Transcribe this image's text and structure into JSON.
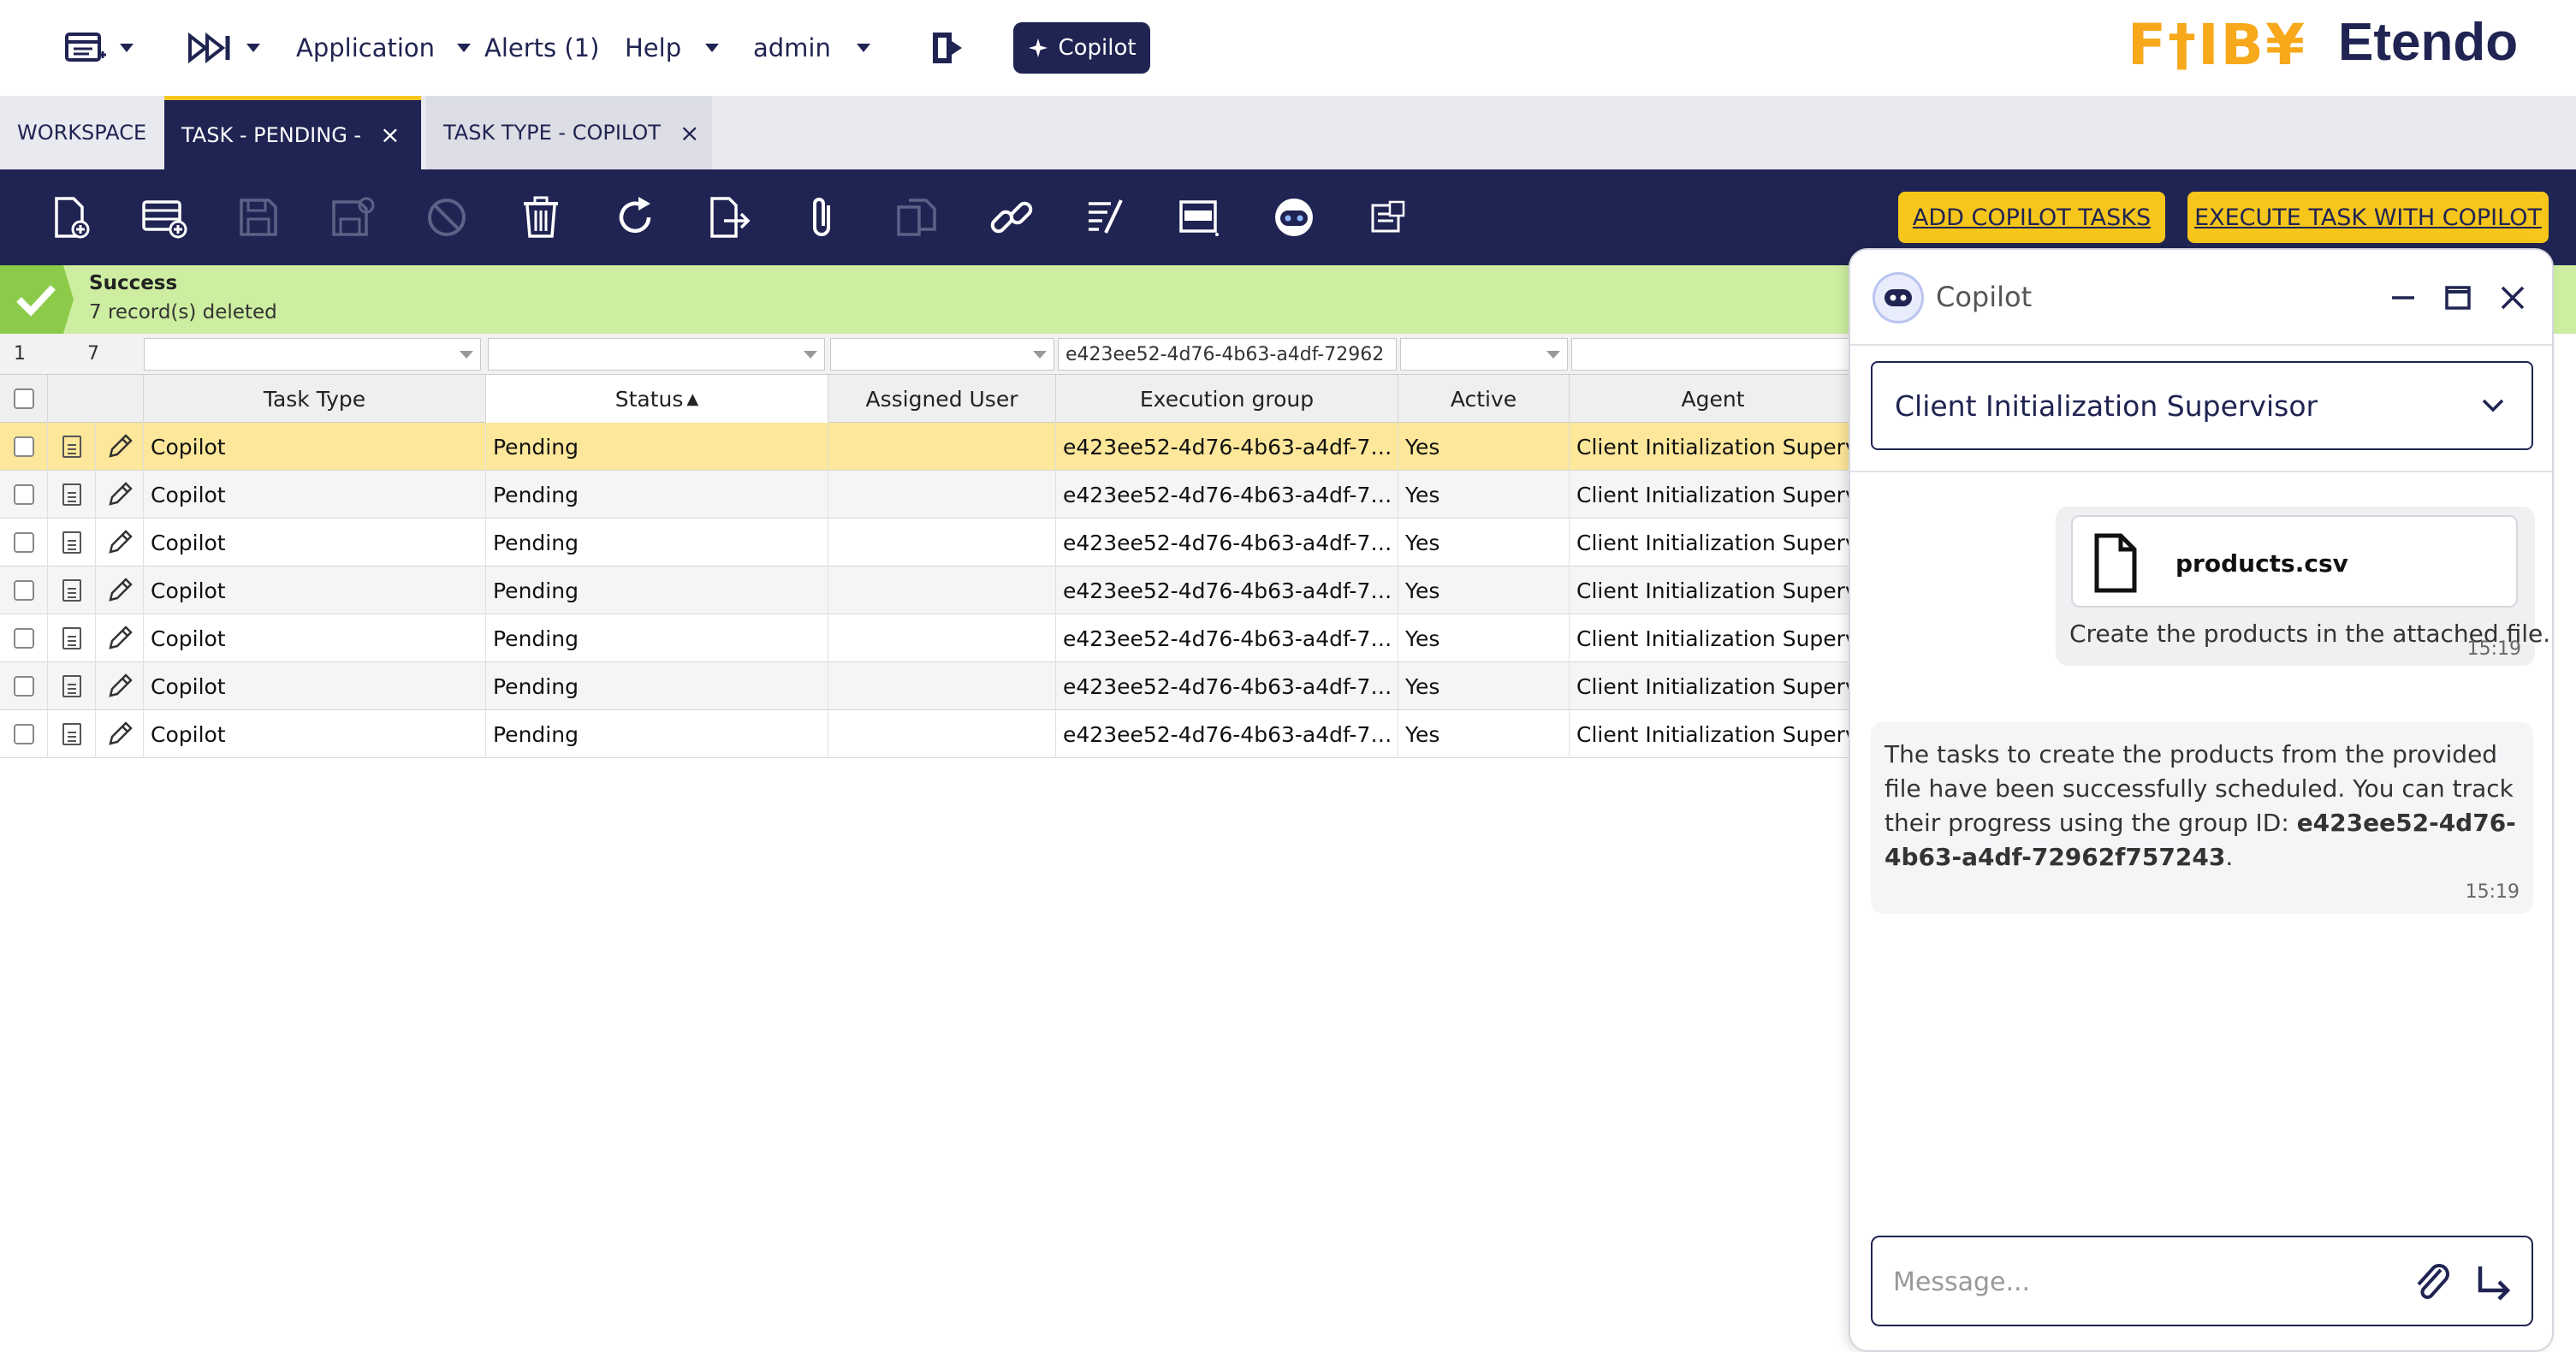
{
  "topbar": {
    "menus": [
      "Application",
      "Alerts (1)",
      "Help",
      "admin"
    ],
    "copilot_label": "Copilot",
    "logo_left": "F†IB¥",
    "logo_right": "Etendo"
  },
  "tabs": [
    {
      "label": "WORKSPACE",
      "closable": false
    },
    {
      "label": "TASK - PENDING -",
      "closable": true,
      "active": true
    },
    {
      "label": "TASK TYPE - COPILOT",
      "closable": true
    }
  ],
  "toolbar": {
    "add_tasks_label": "ADD COPILOT TASKS",
    "execute_label": "EXECUTE TASK WITH COPILOT"
  },
  "message": {
    "title": "Success",
    "text": "7 record(s) deleted",
    "color": "#8ccb4a"
  },
  "grid": {
    "filter_selected": "1",
    "filter_total": "7",
    "filter_execution_group": "e423ee52-4d76-4b63-a4df-72962",
    "columns": [
      "Task Type",
      "Status",
      "Assigned User",
      "Execution group",
      "Active",
      "Agent"
    ],
    "sort_column": "Status",
    "rows": [
      {
        "task_type": "Copilot",
        "status": "Pending",
        "assigned_user": "",
        "execution_group": "e423ee52-4d76-4b63-a4df-7…",
        "active": "Yes",
        "agent": "Client Initialization Supervisor"
      },
      {
        "task_type": "Copilot",
        "status": "Pending",
        "assigned_user": "",
        "execution_group": "e423ee52-4d76-4b63-a4df-7…",
        "active": "Yes",
        "agent": "Client Initialization Supervisor"
      },
      {
        "task_type": "Copilot",
        "status": "Pending",
        "assigned_user": "",
        "execution_group": "e423ee52-4d76-4b63-a4df-7…",
        "active": "Yes",
        "agent": "Client Initialization Supervisor"
      },
      {
        "task_type": "Copilot",
        "status": "Pending",
        "assigned_user": "",
        "execution_group": "e423ee52-4d76-4b63-a4df-7…",
        "active": "Yes",
        "agent": "Client Initialization Supervisor"
      },
      {
        "task_type": "Copilot",
        "status": "Pending",
        "assigned_user": "",
        "execution_group": "e423ee52-4d76-4b63-a4df-7…",
        "active": "Yes",
        "agent": "Client Initialization Supervisor"
      },
      {
        "task_type": "Copilot",
        "status": "Pending",
        "assigned_user": "",
        "execution_group": "e423ee52-4d76-4b63-a4df-7…",
        "active": "Yes",
        "agent": "Client Initialization Supervisor"
      },
      {
        "task_type": "Copilot",
        "status": "Pending",
        "assigned_user": "",
        "execution_group": "e423ee52-4d76-4b63-a4df-7…",
        "active": "Yes",
        "agent": "Client Initialization Supervisor"
      }
    ]
  },
  "copilot": {
    "title": "Copilot",
    "agent": "Client Initialization Supervisor",
    "messages": [
      {
        "role": "user",
        "file": "products.csv",
        "text": "Create the products in the attached file.",
        "time": "15:19"
      },
      {
        "role": "assistant",
        "text_prefix": "The tasks to create the products from the provided file have been successfully scheduled. You can track their progress using the group ID: ",
        "group_id": "e423ee52-4d76-4b63-a4df-72962f757243",
        "text_suffix": ".",
        "time": "15:19"
      }
    ],
    "input_placeholder": "Message..."
  },
  "colors": {
    "navy": "#202452",
    "accent_yellow": "#f7c61b",
    "selected_row": "#fde79a",
    "success_bg": "#cdeea0"
  }
}
